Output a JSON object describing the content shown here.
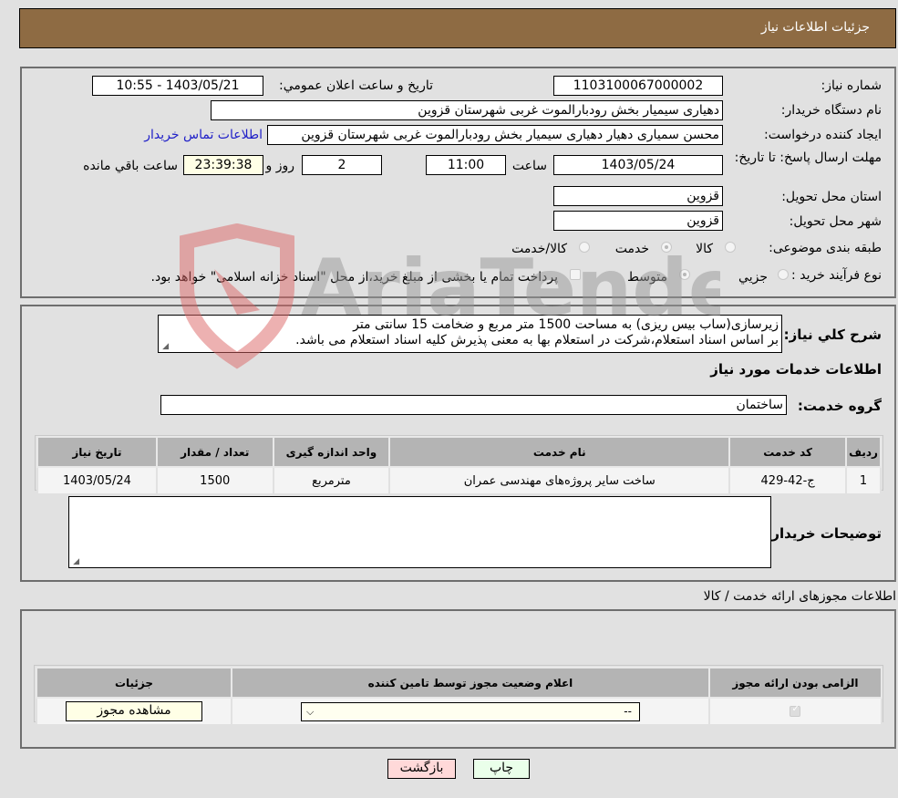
{
  "header": {
    "title": "جزئیات اطلاعات نیاز"
  },
  "form": {
    "need_number_label": "شماره نیاز:",
    "need_number": "1103100067000002",
    "announce_label": "تاریخ و ساعت اعلان عمومي:",
    "announce_value": "1403/05/21 - 10:55",
    "buyer_org_label": "نام دستگاه خریدار:",
    "buyer_org": "دهیاری سیمیار بخش رودبارالموت غربی شهرستان قزوین",
    "creator_label": "ایجاد کننده درخواست:",
    "creator": "محسن سمیاری دهیار دهیاری سیمیار بخش رودبارالموت غربی شهرستان قزوین",
    "contact_link": "اطلاعات تماس خریدار",
    "deadline_label": "مهلت ارسال پاسخ: تا تاریخ:",
    "deadline_date": "1403/05/24",
    "time_label": "ساعت",
    "deadline_time": "11:00",
    "days_value": "2",
    "days_label": "روز و",
    "remaining_time": "23:39:38",
    "remaining_label": "ساعت باقي مانده",
    "province_label": "استان محل تحویل:",
    "province": "قزوین",
    "city_label": "شهر محل تحویل:",
    "city": "قزوین",
    "category_label": "طبقه بندی موضوعی:",
    "category_options": [
      {
        "label": "کالا",
        "selected": false
      },
      {
        "label": "خدمت",
        "selected": true
      },
      {
        "label": "کالا/خدمت",
        "selected": false
      }
    ],
    "process_label": "نوع فرآیند خرید :",
    "process_options": [
      {
        "label": "جزيي",
        "selected": false
      },
      {
        "label": "متوسط",
        "selected": true
      }
    ],
    "treasury_note": "پرداخت تمام یا بخشی از مبلغ خرید،از محل \"اسناد خزانه اسلامی\" خواهد بود.",
    "treasury_checked": false
  },
  "description": {
    "label": "شرح کلي نیاز:",
    "line1": "زیرسازی(ساب بیس ریزی) به مساحت 1500 متر مربع و ضخامت 15 سانتی متر",
    "line2": "بر اساس اسناد استعلام،شرکت در استعلام بها به معنی پذیرش کلیه اسناد استعلام می باشد."
  },
  "services": {
    "section_title": "اطلاعات خدمات مورد نیاز",
    "group_label": "گروه خدمت:",
    "group_value": "ساختمان",
    "columns": [
      "ردیف",
      "کد خدمت",
      "نام خدمت",
      "واحد اندازه گیری",
      "تعداد / مقدار",
      "تاریخ نیاز"
    ],
    "rows": [
      {
        "index": "1",
        "code": "ج-42-429",
        "name": "ساخت سایر پروژه‌های مهندسی عمران",
        "unit": "مترمربع",
        "qty": "1500",
        "date": "1403/05/24"
      }
    ],
    "buyer_notes_label": "توضیحات خریدار:",
    "buyer_notes": ""
  },
  "licenses": {
    "section_title": "اطلاعات مجوزهای ارائه خدمت / کالا",
    "columns": [
      "الزامی بودن ارائه مجوز",
      "اعلام وضعیت مجوز توسط تامین کننده",
      "جزئیات"
    ],
    "rows": [
      {
        "required_checked": true,
        "status_value": "--",
        "details_button": "مشاهده مجوز"
      }
    ]
  },
  "buttons": {
    "print": "چاپ",
    "back": "بازگشت"
  },
  "watermark": {
    "text": "AriaTender.neT"
  },
  "colors": {
    "header_bg": "#8e6b43",
    "link": "#2020c8",
    "print_bg": "#eaffea",
    "back_bg": "#ffd9d9"
  }
}
